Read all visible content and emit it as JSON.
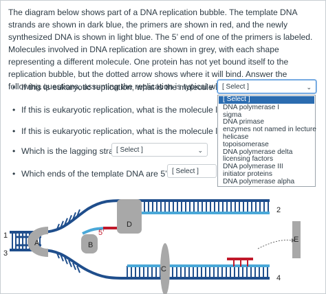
{
  "intro": "The diagram below shows part of a DNA replication bubble.  The template DNA strands are shown in dark blue, the primers are shown in red, and the newly synthesized DNA is shown in light blue.  The 5’ end of one of the primers is labeled.  Molecules involved in DNA replication are shown in grey, with each shape representing a different molecule.  One protein has not yet bound itself to the replication bubble, but the dotted arrow shows where it will bind.  Answer the following questions, assuming the replication is typical with no errors.",
  "bullet": "•",
  "questions": [
    {
      "text": "If this is eukaryotic replication, what is the molecule labeled B?",
      "select": "[ Select ]"
    },
    {
      "text": "If this is eukaryotic replication, what is the molecule labeled C?"
    },
    {
      "text": "If this is eukaryotic replication, what is the molecule labeled D?"
    },
    {
      "text": "Which is the lagging strand?",
      "select": "[ Select ]"
    },
    {
      "text": "Which ends of the template DNA are 5’ ends?",
      "select": "[ Select ]"
    }
  ],
  "dropdown_options": [
    "[ Select ]",
    "DNA polymerase I",
    "sigma",
    "DNA primase",
    "enzymes not named in lecture",
    "helicase",
    "topoisomerase",
    "DNA polymerase delta",
    "licensing factors",
    "DNA polymerase III",
    "initiator proteins",
    "DNA polymerase alpha"
  ],
  "chevron": "⌄",
  "diagram": {
    "labels": {
      "A": "A",
      "B": "B",
      "C": "C",
      "D": "D",
      "E": "E",
      "n1": "1",
      "n2": "2",
      "n3": "3",
      "n4": "4",
      "five_prime": "5’"
    },
    "colors": {
      "template": "#1f4e8c",
      "primer": "#c0182a",
      "new": "#4aa8d8",
      "protein": "#a8a8a8"
    }
  }
}
